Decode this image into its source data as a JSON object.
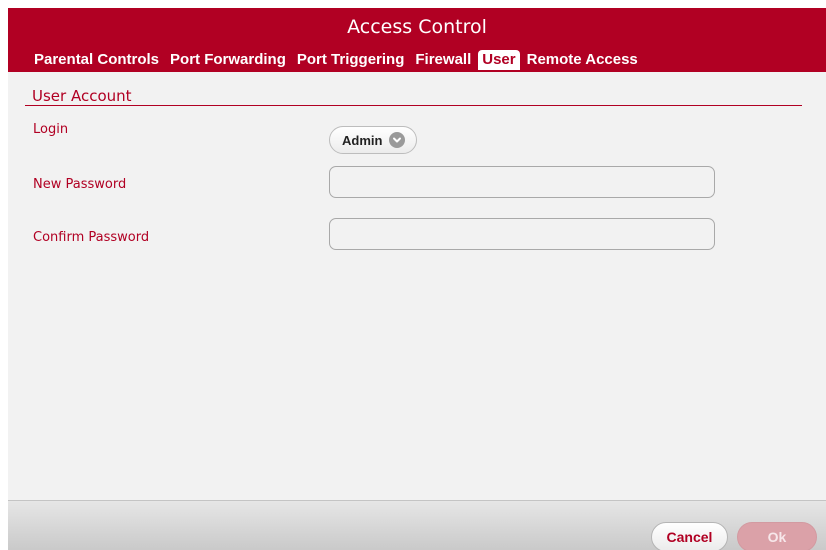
{
  "window": {
    "title": "Access Control"
  },
  "tabs": [
    {
      "label": "Parental Controls",
      "active": false
    },
    {
      "label": "Port Forwarding",
      "active": false
    },
    {
      "label": "Port Triggering",
      "active": false
    },
    {
      "label": "Firewall",
      "active": false
    },
    {
      "label": "User",
      "active": true
    },
    {
      "label": "Remote Access",
      "active": false
    }
  ],
  "section": {
    "title": "User Account"
  },
  "form": {
    "login_label": "Login",
    "login_value": "Admin",
    "new_password_label": "New Password",
    "new_password_value": "",
    "confirm_password_label": "Confirm Password",
    "confirm_password_value": ""
  },
  "footer": {
    "cancel_label": "Cancel",
    "ok_label": "Ok"
  },
  "colors": {
    "brand": "#b10023",
    "page_background": "#f2f2f2",
    "ok_disabled": "#dba1a8"
  },
  "icons": {
    "login_select": "chevron-down-circle-icon"
  }
}
